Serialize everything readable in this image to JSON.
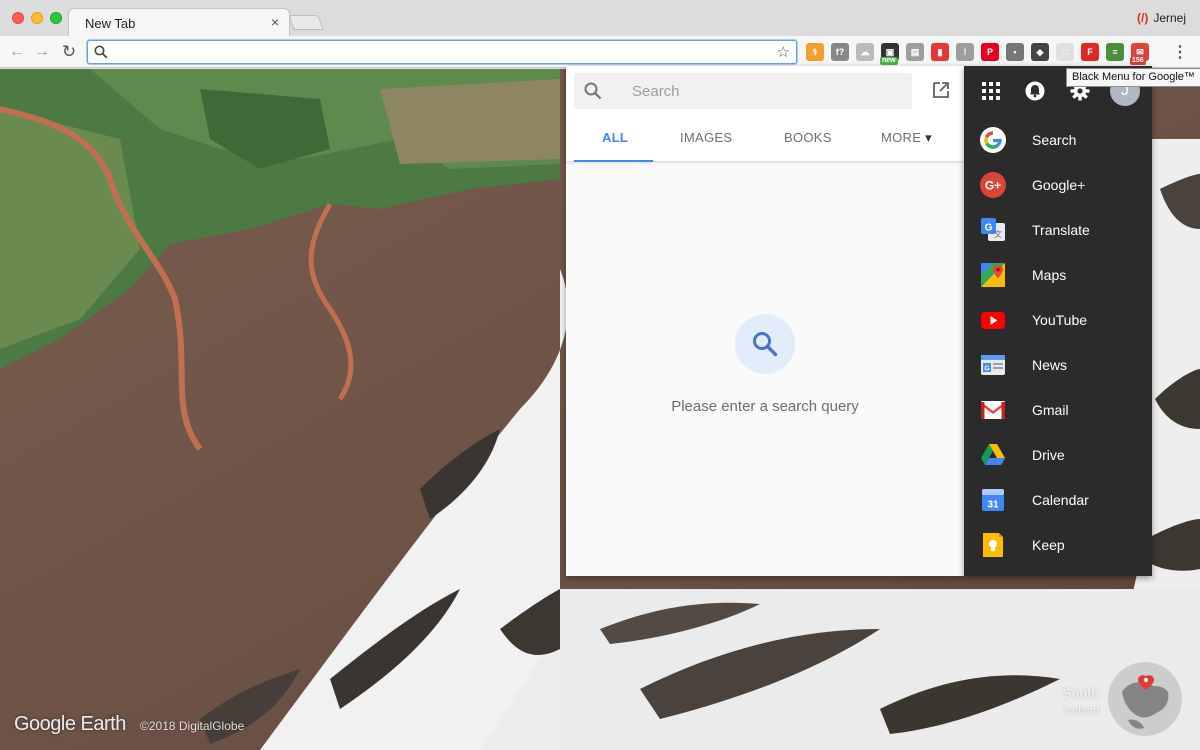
{
  "browser": {
    "tab_title": "New Tab",
    "tab_close": "×",
    "profile_name": "Jernej",
    "address_value": "",
    "tooltip": "Black Menu for Google™",
    "extensions": [
      {
        "name": "dev-tools-ext",
        "color": "#f0a030",
        "glyph": "⚕"
      },
      {
        "name": "formula-ext",
        "color": "#888888",
        "glyph": "f?"
      },
      {
        "name": "cloud-ext",
        "color": "#bbbbbb",
        "glyph": "☁"
      },
      {
        "name": "new-ext",
        "color": "#333333",
        "glyph": "▣",
        "badge": "new",
        "badge_color": "#4caf50"
      },
      {
        "name": "slides-ext",
        "color": "#9e9e9e",
        "glyph": "▤"
      },
      {
        "name": "bookmark-ext",
        "color": "#e53935",
        "glyph": "▮"
      },
      {
        "name": "info-ext",
        "color": "#9e9e9e",
        "glyph": "!"
      },
      {
        "name": "pinterest-ext",
        "color": "#e60023",
        "glyph": "P"
      },
      {
        "name": "bulb-ext",
        "color": "#777777",
        "glyph": "•"
      },
      {
        "name": "evernote-ext",
        "color": "#444444",
        "glyph": "◆"
      },
      {
        "name": "docs-ext",
        "color": "#e0e0e0",
        "glyph": "□"
      },
      {
        "name": "flipboard-ext",
        "color": "#e12828",
        "glyph": "F"
      },
      {
        "name": "black-menu-ext",
        "color": "#4b8f3a",
        "glyph": "≡"
      },
      {
        "name": "gmail-ext",
        "color": "#db4437",
        "glyph": "✉",
        "badge": "156",
        "badge_color": "#db4437"
      }
    ]
  },
  "search_panel": {
    "placeholder": "Search",
    "tabs": [
      "ALL",
      "IMAGES",
      "BOOKS",
      "MORE"
    ],
    "more_caret": "▾",
    "empty_message": "Please enter a search query"
  },
  "black_menu": {
    "avatar_initial": "J",
    "items": [
      {
        "label": "Search",
        "icon": "google-icon"
      },
      {
        "label": "Google+",
        "icon": "google-plus-icon"
      },
      {
        "label": "Translate",
        "icon": "translate-icon"
      },
      {
        "label": "Maps",
        "icon": "maps-icon"
      },
      {
        "label": "YouTube",
        "icon": "youtube-icon"
      },
      {
        "label": "News",
        "icon": "news-icon"
      },
      {
        "label": "Gmail",
        "icon": "gmail-icon"
      },
      {
        "label": "Drive",
        "icon": "drive-icon"
      },
      {
        "label": "Calendar",
        "icon": "calendar-icon"
      },
      {
        "label": "Keep",
        "icon": "keep-icon"
      }
    ],
    "calendar_day": "31"
  },
  "earth": {
    "logo": "Google Earth",
    "copyright": "©2018 DigitalGlobe",
    "location_title": "South",
    "location_subtitle": "Iceland"
  },
  "colors": {
    "accent": "#4285f4",
    "menu_bg": "#2b2b2b"
  }
}
